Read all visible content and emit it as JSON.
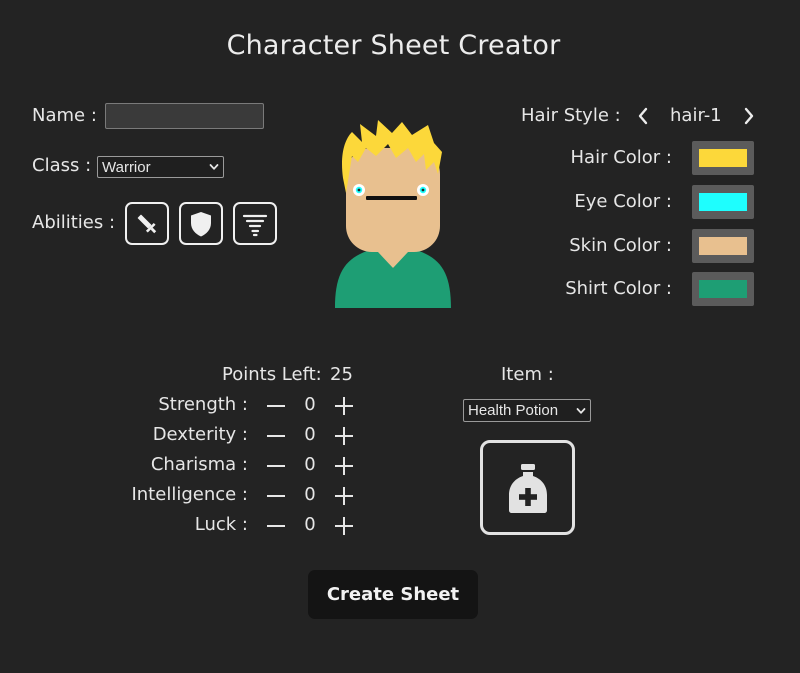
{
  "app": {
    "title": "Character Sheet Creator"
  },
  "form": {
    "name_label": "Name :",
    "name_value": "",
    "class_label": "Class :",
    "class_selected": "Warrior",
    "abilities_label": "Abilities :",
    "abilities": [
      {
        "icon": "sword-icon"
      },
      {
        "icon": "shield-icon"
      },
      {
        "icon": "tornado-icon"
      }
    ]
  },
  "appearance": {
    "hair_style_label": "Hair Style :",
    "hair_style_value": "hair-1",
    "colors": [
      {
        "label": "Hair Color :",
        "value": "#FCD83A"
      },
      {
        "label": "Eye Color :",
        "value": "#1EFEFE"
      },
      {
        "label": "Skin Color :",
        "value": "#E8C08F"
      },
      {
        "label": "Shirt Color :",
        "value": "#1E9E74"
      }
    ]
  },
  "stats": {
    "points_left_label": "Points Left:",
    "points_left": "25",
    "decrement_symbol": "—",
    "increment_symbol": "+",
    "rows": [
      {
        "label": "Strength :",
        "value": "0"
      },
      {
        "label": "Dexterity :",
        "value": "0"
      },
      {
        "label": "Charisma :",
        "value": "0"
      },
      {
        "label": "Intelligence :",
        "value": "0"
      },
      {
        "label": "Luck :",
        "value": "0"
      }
    ]
  },
  "item": {
    "label": "Item :",
    "selected": "Health Potion",
    "icon": "health-potion-icon"
  },
  "actions": {
    "create_label": "Create Sheet"
  }
}
